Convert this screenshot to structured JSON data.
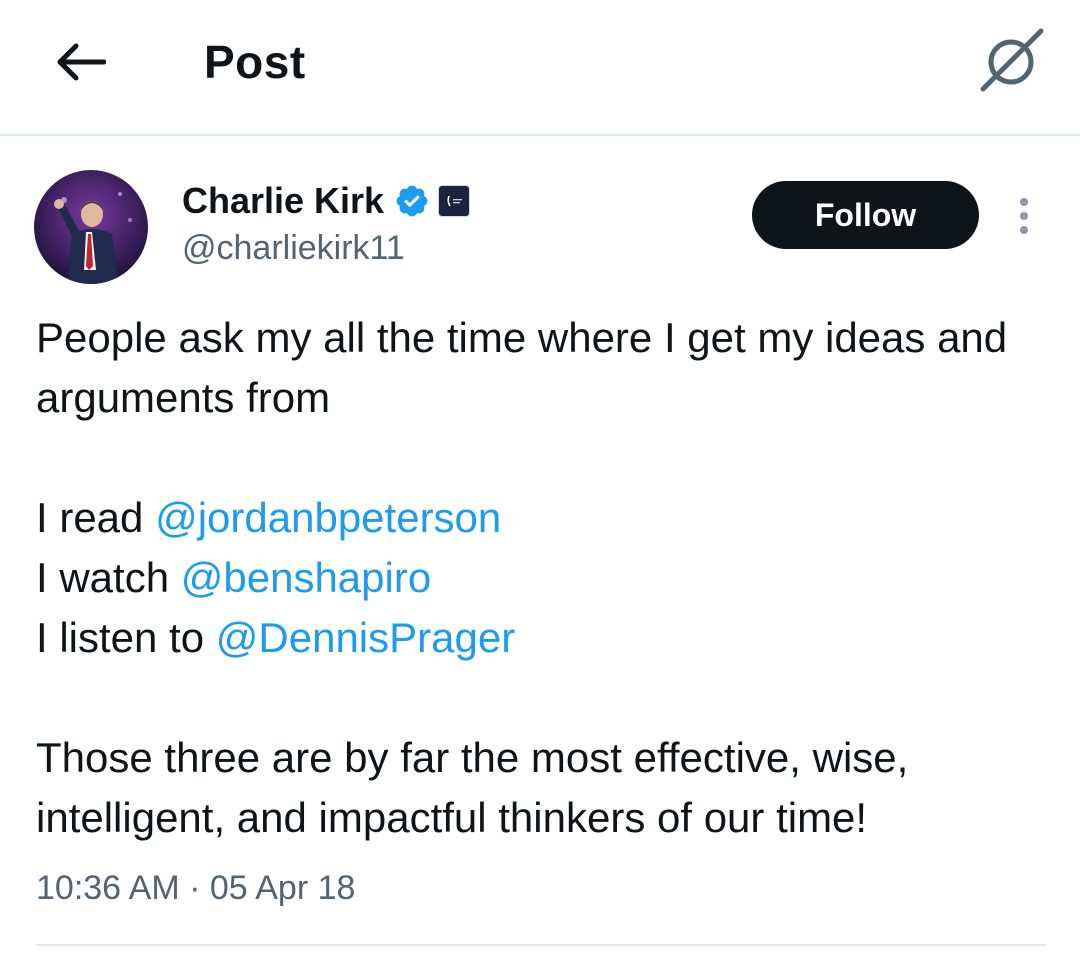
{
  "header": {
    "title": "Post",
    "back_icon": "arrow-left-icon",
    "grok_icon": "grok-icon"
  },
  "author": {
    "name": "Charlie Kirk",
    "handle": "@charliekirk11",
    "verified_color": "#1d9bf0",
    "follow_label": "Follow"
  },
  "tweet": {
    "paragraph1": "People ask my all the time where I get my ideas and arguments from",
    "lines": [
      {
        "prefix": "I read ",
        "mention": "@jordanbpeterson"
      },
      {
        "prefix": "I watch ",
        "mention": "@benshapiro"
      },
      {
        "prefix": "I listen to ",
        "mention": "@DennisPrager"
      }
    ],
    "paragraph3": "Those three are by far the most effective, wise, intelligent, and impactful thinkers of our time!",
    "timestamp": "10:36 AM · 05 Apr 18"
  },
  "colors": {
    "text": "#0f1419",
    "secondary": "#536471",
    "link": "#1d9bf0",
    "divider": "#e3e8ec"
  }
}
